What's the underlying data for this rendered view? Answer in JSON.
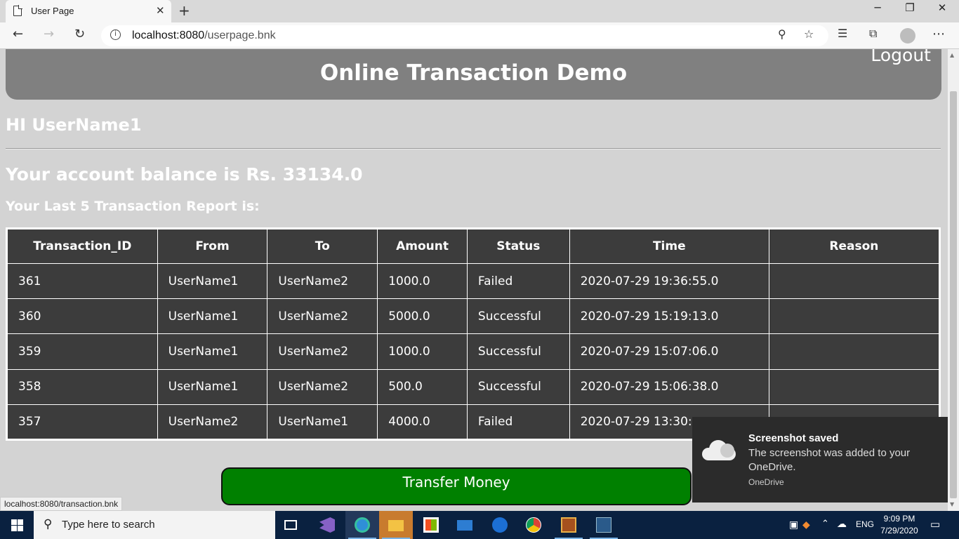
{
  "browser": {
    "tab_title": "User Page",
    "tab_close": "✕",
    "new_tab": "+",
    "url_host": "localhost:8080",
    "url_path": "/userpage.bnk",
    "status_link": "localhost:8080/transaction.bnk"
  },
  "page": {
    "banner_title": "Online Transaction Demo",
    "logout": "Logout",
    "greeting": "HI UserName1",
    "balance": "Your account balance is Rs. 33134.0",
    "report_heading": "Your Last 5 Transaction Report is:",
    "columns": [
      "Transaction_ID",
      "From",
      "To",
      "Amount",
      "Status",
      "Time",
      "Reason"
    ],
    "rows": [
      [
        "361",
        "UserName1",
        "UserName2",
        "1000.0",
        "Failed",
        "2020-07-29 19:36:55.0",
        ""
      ],
      [
        "360",
        "UserName1",
        "UserName2",
        "5000.0",
        "Successful",
        "2020-07-29 15:19:13.0",
        ""
      ],
      [
        "359",
        "UserName1",
        "UserName2",
        "1000.0",
        "Successful",
        "2020-07-29 15:07:06.0",
        ""
      ],
      [
        "358",
        "UserName1",
        "UserName2",
        "500.0",
        "Successful",
        "2020-07-29 15:06:38.0",
        ""
      ],
      [
        "357",
        "UserName2",
        "UserName1",
        "4000.0",
        "Failed",
        "2020-07-29 13:30:",
        ""
      ]
    ],
    "transfer_button": "Transfer Money"
  },
  "toast": {
    "title": "Screenshot saved",
    "body": "The screenshot was added to your OneDrive.",
    "source": "OneDrive"
  },
  "taskbar": {
    "search_placeholder": "Type here to search",
    "language": "ENG",
    "time": "9:09 PM",
    "date": "7/29/2020"
  },
  "colors": {
    "banner": "#808080",
    "page_bg": "#d3d3d3",
    "table_bg": "#3c3c3c",
    "transfer_button": "#008000",
    "taskbar": "#0a2140"
  }
}
